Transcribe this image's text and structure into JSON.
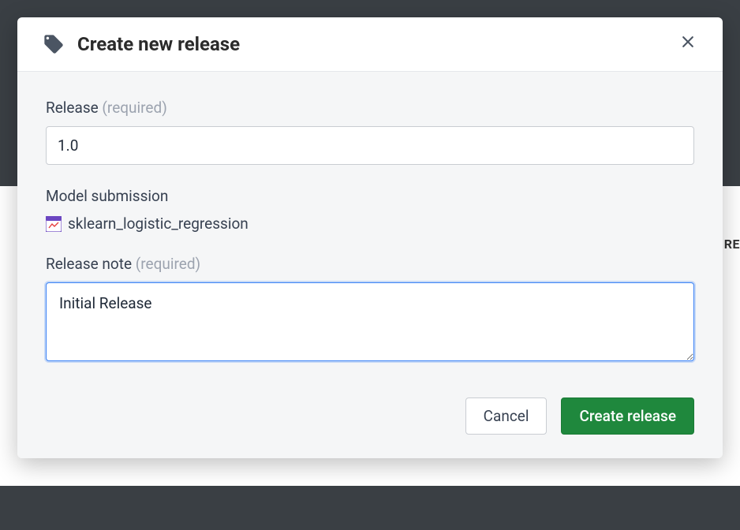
{
  "backdrop": {
    "partial_label": "RE"
  },
  "modal": {
    "title": "Create new release",
    "release_field": {
      "label": "Release",
      "required_suffix": "(required)",
      "value": "1.0"
    },
    "model_submission": {
      "label": "Model submission",
      "value": "sklearn_logistic_regression"
    },
    "release_note": {
      "label": "Release note",
      "required_suffix": "(required)",
      "value": "Initial Release"
    },
    "buttons": {
      "cancel": "Cancel",
      "submit": "Create release"
    }
  }
}
